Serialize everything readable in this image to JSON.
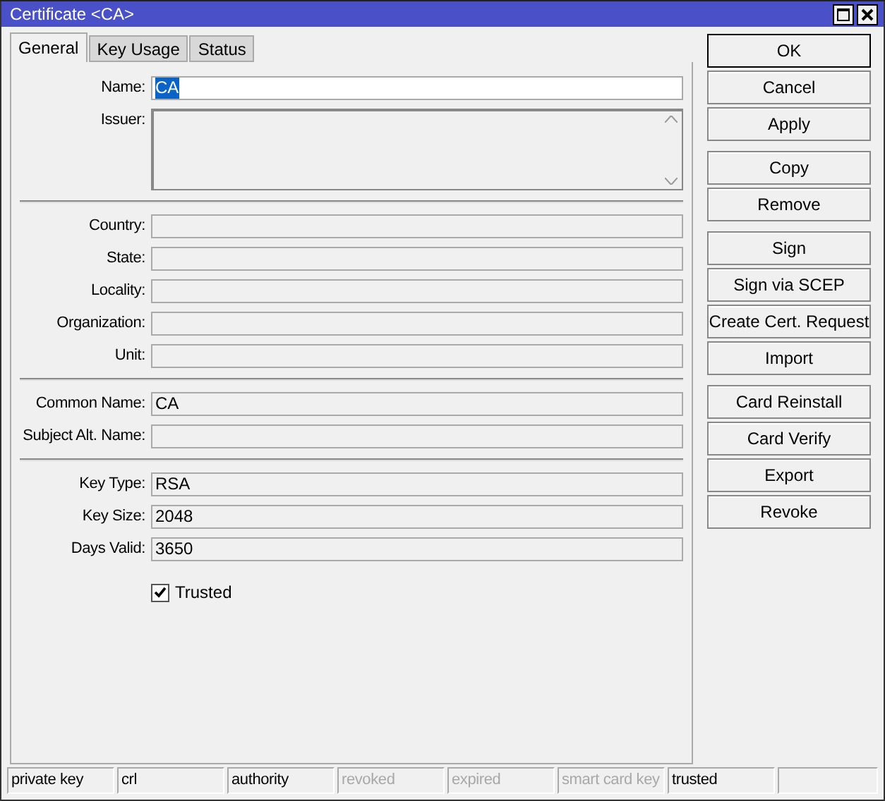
{
  "window": {
    "title": "Certificate <CA>"
  },
  "tabs": [
    {
      "label": "General",
      "selected": true
    },
    {
      "label": "Key Usage",
      "selected": false
    },
    {
      "label": "Status",
      "selected": false
    }
  ],
  "sections": [
    {
      "fields": [
        {
          "label": "Name:",
          "kind": "edit",
          "value": "CA",
          "text_selected": true
        },
        {
          "label": "Issuer:",
          "kind": "multiline"
        }
      ]
    },
    {
      "fields": [
        {
          "label": "Country:",
          "kind": "readonly"
        },
        {
          "label": "State:",
          "kind": "readonly"
        },
        {
          "label": "Locality:",
          "kind": "readonly"
        },
        {
          "label": "Organization:",
          "kind": "readonly"
        },
        {
          "label": "Unit:",
          "kind": "readonly"
        }
      ]
    },
    {
      "fields": [
        {
          "label": "Common Name:",
          "kind": "readonly",
          "value": "CA"
        },
        {
          "label": "Subject Alt. Name:",
          "kind": "readonly"
        }
      ]
    },
    {
      "fields": [
        {
          "label": "Key Type:",
          "kind": "readonly",
          "value": "RSA"
        },
        {
          "label": "Key Size:",
          "kind": "readonly",
          "value": "2048"
        },
        {
          "label": "Days Valid:",
          "kind": "readonly",
          "value": "3650"
        }
      ]
    }
  ],
  "trusted": {
    "label": "Trusted",
    "checked": true
  },
  "button_groups": [
    [
      {
        "label": "OK",
        "default": true
      },
      {
        "label": "Cancel",
        "default": false
      },
      {
        "label": "Apply",
        "default": false
      }
    ],
    [
      {
        "label": "Copy",
        "default": false
      },
      {
        "label": "Remove",
        "default": false
      }
    ],
    [
      {
        "label": "Sign",
        "default": false
      },
      {
        "label": "Sign via SCEP",
        "default": false
      },
      {
        "label": "Create Cert. Request",
        "default": false
      },
      {
        "label": "Import",
        "default": false
      }
    ],
    [
      {
        "label": "Card Reinstall",
        "default": false
      },
      {
        "label": "Card Verify",
        "default": false
      },
      {
        "label": "Export",
        "default": false
      },
      {
        "label": "Revoke",
        "default": false
      }
    ]
  ],
  "status_bar": [
    {
      "label": "private key",
      "disabled": false
    },
    {
      "label": "crl",
      "disabled": false
    },
    {
      "label": "authority",
      "disabled": false
    },
    {
      "label": "revoked",
      "disabled": true
    },
    {
      "label": "expired",
      "disabled": true
    },
    {
      "label": "smart card key",
      "disabled": true
    },
    {
      "label": "trusted",
      "disabled": false
    }
  ]
}
